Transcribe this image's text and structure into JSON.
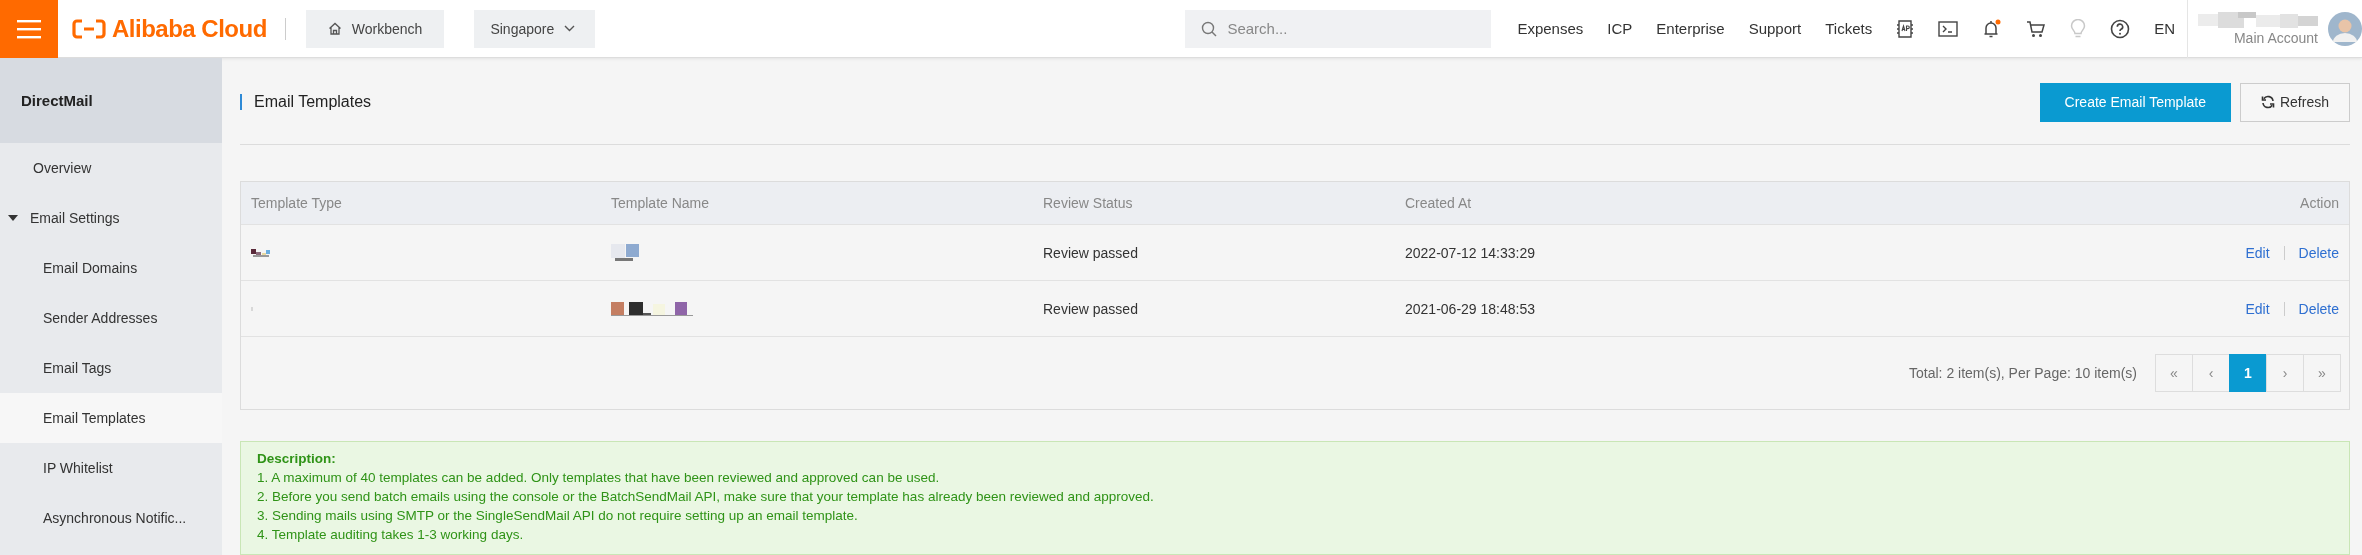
{
  "top_bar": {
    "logo": "Alibaba Cloud",
    "workbench": "Workbench",
    "region": "Singapore",
    "search": {
      "placeholder": "Search..."
    },
    "links": [
      "Expenses",
      "ICP",
      "Enterprise",
      "Support",
      "Tickets"
    ],
    "language": "EN",
    "account": {
      "name_pixelated": true,
      "label": "Main Account"
    }
  },
  "sidebar": {
    "title": "DirectMail",
    "items": [
      {
        "label": "Overview",
        "selected": false
      },
      {
        "label": "Email Settings",
        "selected": false,
        "expanded": true,
        "children": [
          {
            "label": "Email Domains",
            "selected": false
          },
          {
            "label": "Sender Addresses",
            "selected": false
          },
          {
            "label": "Email Tags",
            "selected": false
          },
          {
            "label": "Email Templates",
            "selected": true
          },
          {
            "label": "IP Whitelist",
            "selected": false
          },
          {
            "label": "Asynchronous Notific...",
            "selected": false
          }
        ]
      }
    ]
  },
  "page": {
    "title": "Email Templates",
    "buttons": [
      {
        "label": "Create Email Template",
        "kind": "primary"
      },
      {
        "label": "Refresh",
        "kind": "refresh"
      }
    ]
  },
  "table": {
    "columns": [
      "Template Type",
      "Template Name",
      "Review Status",
      "Created At",
      "Action"
    ],
    "rows": [
      {
        "template_type": {
          "kind": "pixelated"
        },
        "template_name": {
          "kind": "pixelated"
        },
        "review_status": "Review passed",
        "created_at": "2022-07-12 14:33:29",
        "actions": [
          "Edit",
          "Delete"
        ]
      },
      {
        "template_type": {
          "kind": "pixelated"
        },
        "template_name": {
          "kind": "pixelated"
        },
        "review_status": "Review passed",
        "created_at": "2021-06-29 18:48:53",
        "actions": [
          "Edit",
          "Delete"
        ]
      }
    ],
    "summary": "Total: 2 item(s), Per Page: 10 item(s)",
    "pagination": [
      {
        "label": "«",
        "selected": false
      },
      {
        "label": "‹",
        "selected": false
      },
      {
        "label": "1",
        "selected": true
      },
      {
        "label": "›",
        "selected": false
      },
      {
        "label": "»",
        "selected": false
      }
    ]
  },
  "description": {
    "title": "Description:",
    "lines": [
      "1. A maximum of 40 templates can be added. Only templates that have been reviewed and approved can be used.",
      "2. Before you send batch emails using the console or the BatchSendMail API, make sure that your template has already been reviewed and approved.",
      "3. Sending mails using SMTP or the SingleSendMail API do not require setting up an email template.",
      "4. Template auditing takes 1-3 working days."
    ]
  }
}
